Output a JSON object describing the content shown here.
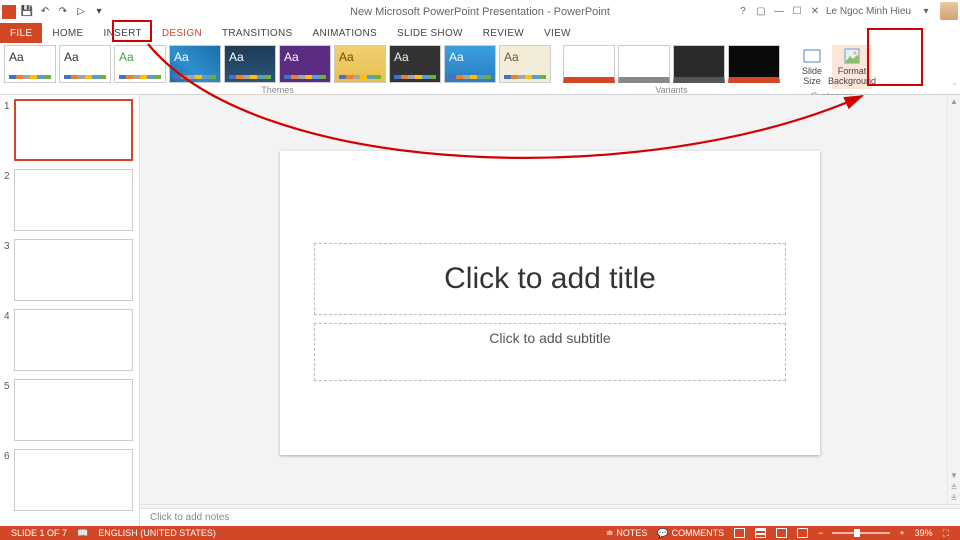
{
  "titlebar": {
    "title": "New Microsoft PowerPoint Presentation - PowerPoint",
    "user": "Le Ngoc Minh Hieu"
  },
  "tabs": [
    "FILE",
    "HOME",
    "INSERT",
    "DESIGN",
    "TRANSITIONS",
    "ANIMATIONS",
    "SLIDE SHOW",
    "REVIEW",
    "VIEW"
  ],
  "active_tab": "DESIGN",
  "themes": {
    "group_label": "Themes",
    "items": [
      {
        "aa": "Aa",
        "bg": "#ffffff",
        "fg": "#333"
      },
      {
        "aa": "Aa",
        "bg": "#ffffff",
        "fg": "#333"
      },
      {
        "aa": "Aa",
        "bg": "#ffffff",
        "fg": "#48a23f"
      },
      {
        "aa": "Aa",
        "bg": "linear-gradient(45deg,#1b6ea8,#2f8fcf 40%,#1b6ea8)",
        "fg": "#fff"
      },
      {
        "aa": "Aa",
        "bg": "linear-gradient(#1f3b57,#2a5578)",
        "fg": "#fff"
      },
      {
        "aa": "Aa",
        "bg": "#5a2d82",
        "fg": "#fff"
      },
      {
        "aa": "Aa",
        "bg": "linear-gradient(#f0d070,#e8c050)",
        "fg": "#6b4a10"
      },
      {
        "aa": "Aa",
        "bg": "#333333",
        "fg": "#eee"
      },
      {
        "aa": "Aa",
        "bg": "linear-gradient(#3aa0e0,#2a7ec0)",
        "fg": "#fff"
      },
      {
        "aa": "Aa",
        "bg": "#f3ecd8",
        "fg": "#6b5a2d"
      }
    ]
  },
  "variants": {
    "group_label": "Variants",
    "items": [
      {
        "bg": "#ffffff",
        "accent": "#d24726"
      },
      {
        "bg": "#ffffff",
        "accent": "#888888"
      },
      {
        "bg": "#2b2b2b",
        "accent": "#555"
      },
      {
        "bg": "#0a0a0a",
        "accent": "#d24726"
      }
    ]
  },
  "customize": {
    "group_label": "Customize",
    "slide_size": "Slide\nSize",
    "format_bg": "Format\nBackground"
  },
  "slide": {
    "title_ph": "Click to add title",
    "subtitle_ph": "Click to add subtitle"
  },
  "notes_placeholder": "Click to add notes",
  "status": {
    "slide_indicator": "SLIDE 1 OF 7",
    "language": "ENGLISH (UNITED STATES)",
    "notes_btn": "NOTES",
    "comments_btn": "COMMENTS",
    "zoom": "39%"
  },
  "slide_count": 6
}
